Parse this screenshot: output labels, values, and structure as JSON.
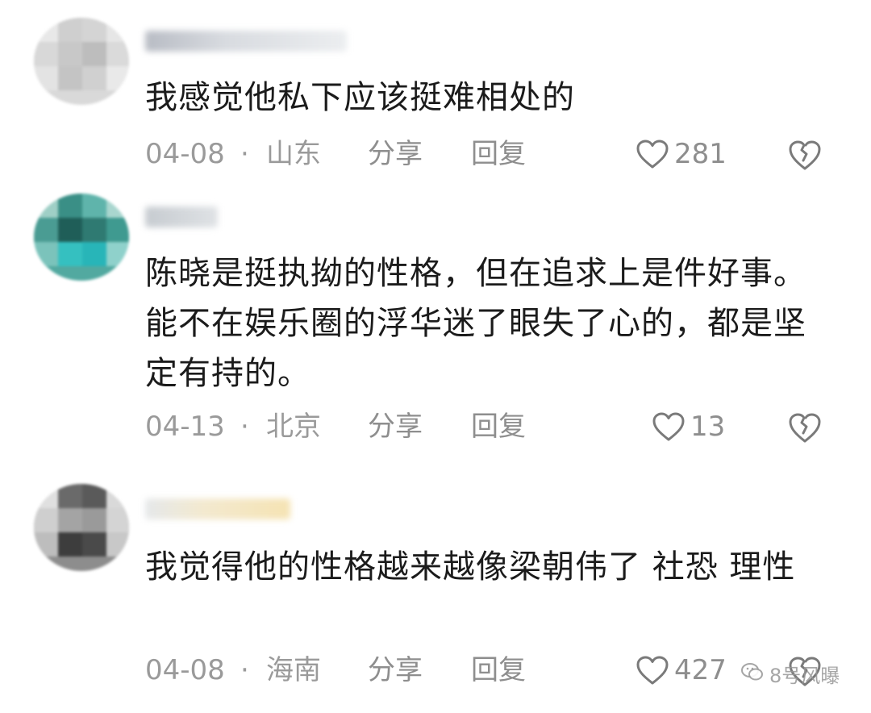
{
  "actions": {
    "share_label": "分享",
    "reply_label": "回复",
    "separator": "·"
  },
  "comments": [
    {
      "username": "",
      "text": "我感觉他私下应该挺难相处的",
      "date": "04-08",
      "location": "山东",
      "likes": "281"
    },
    {
      "username": "",
      "text": "陈晓是挺执拗的性格，但在追求上是件好事。能不在娱乐圈的浮华迷了眼失了心的，都是坚定有持的。",
      "date": "04-13",
      "location": "北京",
      "likes": "13"
    },
    {
      "username": "",
      "text": "我觉得他的性格越来越像梁朝伟了 社恐 理性",
      "date": "04-08",
      "location": "海南",
      "likes": "427"
    }
  ],
  "watermark": {
    "text": "8号风曝",
    "icon": "wechat-icon"
  },
  "colors": {
    "meta_text": "#9a9a9a",
    "body_text": "#1b1b1b",
    "icon_stroke": "#7a7a7a"
  }
}
